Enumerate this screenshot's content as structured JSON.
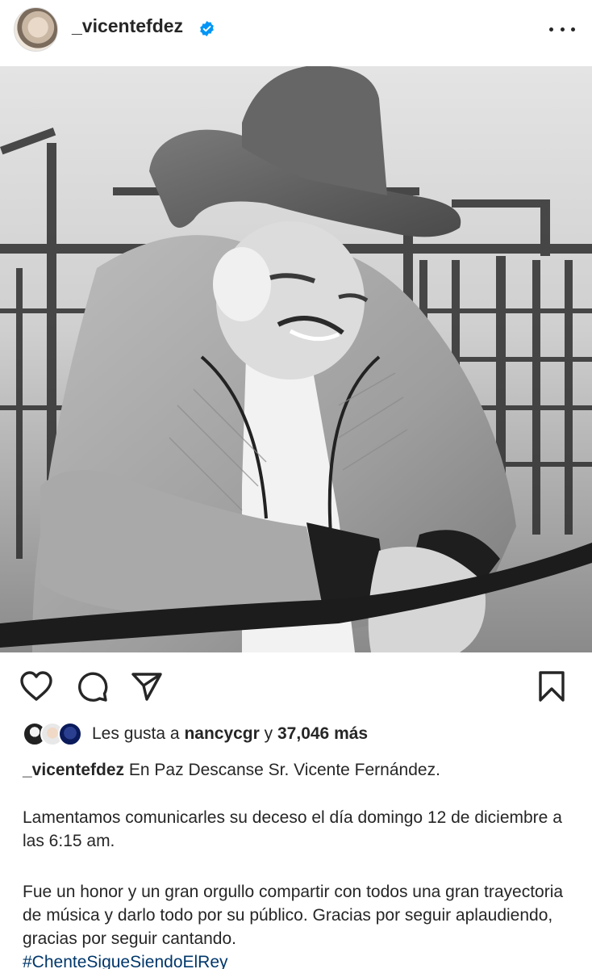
{
  "post": {
    "username": "_vicentefdez",
    "verified_icon": "verified-badge-icon",
    "more_icon": "more-options-icon"
  },
  "photo": {
    "description_icon": "post-photo"
  },
  "actions": {
    "icons": [
      "heart-icon",
      "comment-icon",
      "share-icon",
      "bookmark-icon"
    ]
  },
  "likes": {
    "prefix": "Les gusta a",
    "liker": "nancycgr",
    "conj": "y",
    "count": "37,046 más"
  },
  "caption": {
    "username": "_vicentefdez",
    "line1": "En Paz Descanse Sr. Vicente Fernández.",
    "para2": "Lamentamos comunicarles su deceso el día domingo 12 de diciembre a las 6:15 am.",
    "para3": "Fue un honor y un gran orgullo compartir con todos una gran trayectoria de música y darlo todo por su público. Gracias por seguir aplaudiendo, gracias por seguir cantando.",
    "hashtag": "#ChenteSigueSiendoElRey"
  },
  "colors": {
    "text": "#262626",
    "hashtag": "#00376b",
    "verified": "#0095f6"
  }
}
